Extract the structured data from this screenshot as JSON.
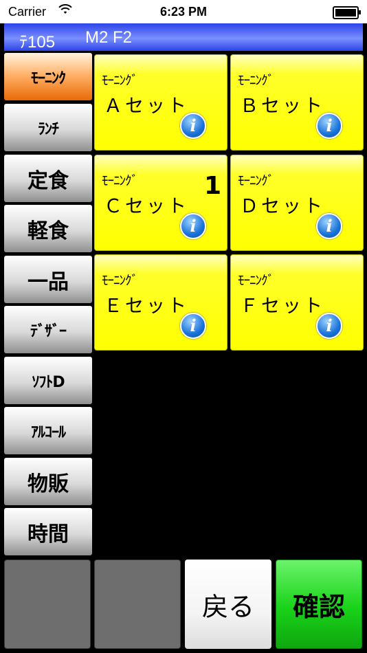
{
  "status_bar": {
    "carrier": "Carrier",
    "time": "6:23 PM"
  },
  "header": {
    "table": "ﾃ105",
    "code": "M2 F2"
  },
  "categories": [
    {
      "label": "ﾓｰﾆﾝｸ",
      "active": true
    },
    {
      "label": "ﾗﾝﾁ"
    },
    {
      "label": "定食"
    },
    {
      "label": "軽食"
    },
    {
      "label": "一品"
    },
    {
      "label": "ﾃﾞｻﾞｰ"
    },
    {
      "label": "ｿﾌﾄD"
    },
    {
      "label": "ｱﾙｺｰﾙ"
    },
    {
      "label": "物販"
    },
    {
      "label": "時間"
    }
  ],
  "items": [
    {
      "category": "ﾓｰﾆﾝｸﾞ",
      "name": "Ａセット",
      "count": ""
    },
    {
      "category": "ﾓｰﾆﾝｸﾞ",
      "name": "Ｂセット",
      "count": ""
    },
    {
      "category": "ﾓｰﾆﾝｸﾞ",
      "name": "Ｃセット",
      "count": "1"
    },
    {
      "category": "ﾓｰﾆﾝｸﾞ",
      "name": "Ｄセット",
      "count": ""
    },
    {
      "category": "ﾓｰﾆﾝｸﾞ",
      "name": "Ｅセット",
      "count": ""
    },
    {
      "category": "ﾓｰﾆﾝｸﾞ",
      "name": "Ｆセット",
      "count": ""
    }
  ],
  "info_icon_glyph": "i",
  "footer": {
    "back_label": "戻る",
    "confirm_label": "確認"
  },
  "colors": {
    "header": "#3a52f0",
    "active_category": "#f07a12",
    "tile": "#ffff00",
    "confirm": "#19d219"
  }
}
